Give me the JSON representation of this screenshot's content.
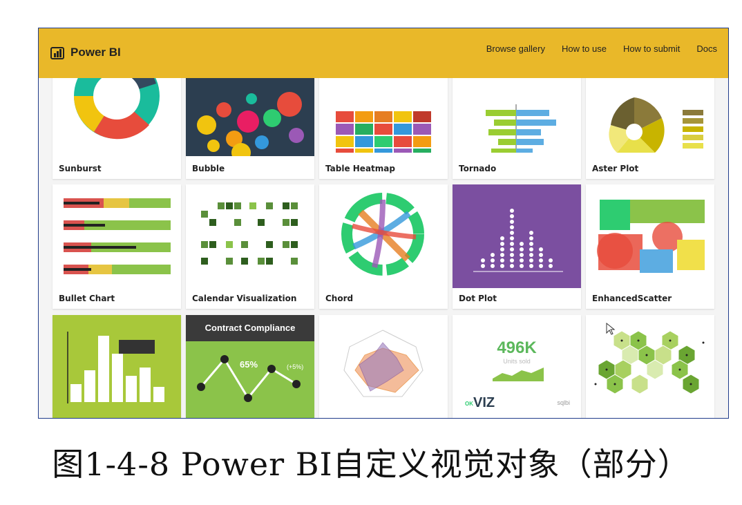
{
  "header": {
    "brand": "Power BI",
    "nav": [
      "Browse gallery",
      "How to use",
      "How to submit",
      "Docs"
    ],
    "bg_color": "#e9b829"
  },
  "cards": [
    {
      "label": "Sunburst"
    },
    {
      "label": "Bubble"
    },
    {
      "label": "Table Heatmap"
    },
    {
      "label": "Tornado"
    },
    {
      "label": "Aster Plot"
    },
    {
      "label": "Bullet Chart"
    },
    {
      "label": "Calendar Visualization"
    },
    {
      "label": "Chord"
    },
    {
      "label": "Dot Plot"
    },
    {
      "label": "EnhancedScatter"
    }
  ],
  "third_row": {
    "contract_title": "Contract Compliance",
    "contract_value": "65%",
    "contract_badge": "(+5%)",
    "kpi_value": "496K",
    "kpi_sub": "Units sold",
    "okviz_prefix": "OK",
    "okviz_logo": "VIZ",
    "sqlbi": "sqlbi"
  },
  "caption": "图1-4-8    Power BI自定义视觉对象（部分）"
}
